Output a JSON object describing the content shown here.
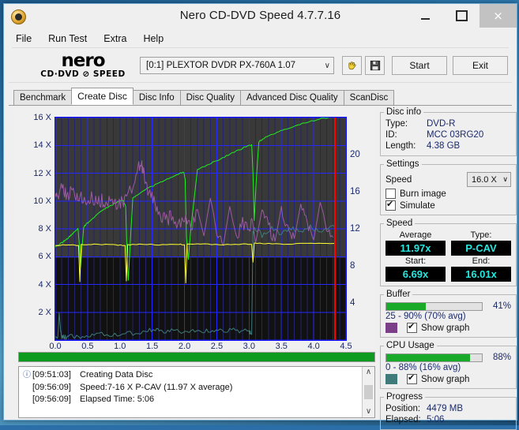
{
  "window": {
    "title": "Nero CD-DVD Speed 4.7.7.16",
    "icon": "disc-icon",
    "minimize": "–",
    "maximize": "□",
    "close": "×"
  },
  "menu": {
    "items": [
      "File",
      "Run Test",
      "Extra",
      "Help"
    ]
  },
  "logo": {
    "word": "nero",
    "sub": "CD·DVD ⊘ SPEED"
  },
  "toolbar": {
    "drive": "[0:1]   PLEXTOR DVDR   PX-760A 1.07",
    "chevron": "∨",
    "hand_icon": "hand-icon",
    "save_icon": "floppy-disk-icon",
    "start_label": "Start",
    "exit_label": "Exit"
  },
  "tabs": [
    {
      "label": "Benchmark",
      "active": false
    },
    {
      "label": "Create Disc",
      "active": true
    },
    {
      "label": "Disc Info",
      "active": false
    },
    {
      "label": "Disc Quality",
      "active": false
    },
    {
      "label": "Advanced Disc Quality",
      "active": false
    },
    {
      "label": "ScanDisc",
      "active": false
    }
  ],
  "disc_info": {
    "legend": "Disc info",
    "type_label": "Type:",
    "type_value": "DVD-R",
    "id_label": "ID:",
    "id_value": "MCC 03RG20",
    "length_label": "Length:",
    "length_value": "4.38 GB"
  },
  "settings": {
    "legend": "Settings",
    "speed_label": "Speed",
    "speed_value": "16.0 X",
    "chevron": "∨",
    "burn_image_label": "Burn image",
    "burn_image_checked": false,
    "simulate_label": "Simulate",
    "simulate_checked": true
  },
  "speed": {
    "legend": "Speed",
    "average_label": "Average",
    "average_value": "11.97x",
    "type_label": "Type:",
    "type_value": "P-CAV",
    "start_label": "Start:",
    "start_value": "6.69x",
    "end_label": "End:",
    "end_value": "16.01x"
  },
  "buffer": {
    "legend": "Buffer",
    "percent": "41%",
    "fill": 41,
    "range": "25 - 90% (70% avg)",
    "swatch": "#7a3f86",
    "show_graph_label": "Show graph",
    "show_graph_checked": true
  },
  "cpu": {
    "legend": "CPU Usage",
    "percent": "88%",
    "fill": 88,
    "range": "0 - 88% (16% avg)",
    "swatch": "#3f7b7b",
    "show_graph_label": "Show graph",
    "show_graph_checked": true
  },
  "progress": {
    "legend": "Progress",
    "position_label": "Position:",
    "position_value": "4479 MB",
    "elapsed_label": "Elapsed:",
    "elapsed_value": "5:06",
    "bar_fill": 100
  },
  "log": {
    "rows": [
      {
        "icon": "info-icon",
        "time": "[09:51:03]",
        "text": "Creating Data Disc"
      },
      {
        "icon": "",
        "time": "[09:56:09]",
        "text": "Speed:7-16 X P-CAV (11.97 X average)"
      },
      {
        "icon": "",
        "time": "[09:56:09]",
        "text": "Elapsed Time:  5:06"
      }
    ],
    "scroll_up": "∧",
    "scroll_down": "∨"
  },
  "chart_data": {
    "type": "line",
    "title": "",
    "xlabel": "",
    "ylabel": "",
    "xlim": [
      0,
      4.5
    ],
    "ylim": [
      0,
      16
    ],
    "y2lim": [
      0,
      24
    ],
    "grid": true,
    "legend": "none",
    "x_ticks": [
      "0.0",
      "0.5",
      "1.0",
      "1.5",
      "2.0",
      "2.5",
      "3.0",
      "3.5",
      "4.0",
      "4.5"
    ],
    "y_ticks_left": [
      "2 X",
      "4 X",
      "6 X",
      "8 X",
      "10 X",
      "12 X",
      "14 X",
      "16 X"
    ],
    "y_ticks_right": [
      "4",
      "8",
      "12",
      "16",
      "20"
    ],
    "marker_line_x": 4.33,
    "marker_color": "#ff0000",
    "series": [
      {
        "name": "write-speed",
        "color": "#22ee22",
        "axis": "left",
        "x": [
          0.0,
          0.05,
          0.1,
          0.15,
          0.2,
          0.25,
          0.3,
          0.35,
          0.37,
          0.39,
          0.41,
          0.44,
          0.48,
          0.55,
          0.65,
          0.75,
          0.85,
          0.95,
          1.05,
          1.09,
          1.11,
          1.13,
          1.16,
          1.2,
          1.28,
          1.4,
          1.52,
          1.65,
          1.78,
          1.9,
          1.99,
          2.01,
          2.03,
          2.06,
          2.1,
          2.2,
          2.35,
          2.5,
          2.65,
          2.8,
          2.95,
          3.04,
          3.06,
          3.08,
          3.11,
          3.15,
          3.25,
          3.4,
          3.55,
          3.7,
          3.85,
          4.0,
          4.15,
          4.25,
          4.33
        ],
        "y": [
          6.7,
          6.85,
          7.0,
          7.15,
          7.35,
          7.55,
          7.8,
          8.05,
          7.0,
          5.2,
          6.4,
          8.15,
          8.35,
          8.6,
          9.05,
          9.4,
          9.65,
          9.9,
          10.05,
          9.6,
          6.1,
          4.3,
          7.0,
          10.2,
          10.45,
          10.85,
          11.1,
          11.4,
          11.7,
          11.95,
          12.05,
          11.6,
          7.4,
          5.8,
          8.1,
          12.25,
          12.6,
          12.9,
          13.25,
          13.6,
          13.9,
          14.05,
          12.0,
          8.6,
          11.4,
          14.25,
          14.55,
          14.85,
          15.15,
          15.4,
          15.6,
          15.8,
          15.95,
          16.0,
          16.01
        ]
      },
      {
        "name": "cpu-usage",
        "color": "#3f7b7b",
        "axis": "right",
        "x": [
          0.0,
          0.04,
          0.06,
          0.08,
          0.1,
          0.14,
          0.2,
          0.3,
          0.45,
          0.6,
          0.8,
          1.0,
          1.2,
          1.4,
          1.55,
          1.65,
          1.8,
          1.95,
          2.1,
          2.25,
          2.4,
          2.55,
          2.7,
          2.85,
          3.0,
          3.04,
          3.06,
          3.1,
          3.2,
          3.35,
          3.5,
          3.65,
          3.8,
          3.95,
          4.1,
          4.25,
          4.33
        ],
        "y": [
          0.3,
          0.4,
          2.95,
          1.2,
          0.35,
          0.3,
          0.35,
          0.4,
          0.45,
          0.55,
          0.6,
          0.7,
          0.75,
          0.95,
          1.05,
          0.9,
          1.0,
          0.85,
          0.95,
          1.05,
          0.85,
          0.95,
          1.15,
          1.05,
          0.95,
          0.6,
          11.6,
          12.1,
          11.3,
          12.0,
          11.5,
          12.1,
          11.6,
          12.2,
          11.7,
          12.3,
          12.1
        ]
      },
      {
        "name": "buffer-level",
        "color": "#9b5ba0",
        "axis": "left",
        "x": [
          0.0,
          0.05,
          0.12,
          0.18,
          0.25,
          0.32,
          0.4,
          0.48,
          0.56,
          0.64,
          0.72,
          0.8,
          0.88,
          0.96,
          1.04,
          1.12,
          1.2,
          1.28,
          1.34,
          1.36,
          1.4,
          1.48,
          1.56,
          1.64,
          1.72,
          1.8,
          1.9,
          2.0,
          2.1,
          2.2,
          2.3,
          2.4,
          2.5,
          2.6,
          2.7,
          2.8,
          2.9,
          3.0,
          3.05,
          3.1,
          3.2,
          3.3,
          3.4,
          3.5,
          3.6,
          3.7,
          3.8,
          3.9,
          4.0,
          4.1,
          4.2,
          4.3
        ],
        "y": [
          10.8,
          10.6,
          10.95,
          10.4,
          10.7,
          10.1,
          10.3,
          9.95,
          10.2,
          9.9,
          10.05,
          9.8,
          10.0,
          9.7,
          9.95,
          10.35,
          11.1,
          12.3,
          12.7,
          12.1,
          11.2,
          10.35,
          9.6,
          8.9,
          8.6,
          8.95,
          8.4,
          8.7,
          8.1,
          9.4,
          7.5,
          10.2,
          8.0,
          6.8,
          9.6,
          7.4,
          8.5,
          7.9,
          8.6,
          7.0,
          9.3,
          8.2,
          7.1,
          9.5,
          8.1,
          7.3,
          9.8,
          8.4,
          7.2,
          9.9,
          8.3,
          7.4
        ]
      },
      {
        "name": "drive-rpm-or-ref",
        "color": "#ffff33",
        "axis": "left",
        "x": [
          0.0,
          0.2,
          0.36,
          0.38,
          0.4,
          0.6,
          0.9,
          1.08,
          1.1,
          1.12,
          1.3,
          1.6,
          1.9,
          2.0,
          2.02,
          2.04,
          2.3,
          2.6,
          2.9,
          3.04,
          3.06,
          3.08,
          3.3,
          3.6,
          3.9,
          4.2,
          4.33
        ],
        "y": [
          6.8,
          6.85,
          6.8,
          4.2,
          6.85,
          6.9,
          6.85,
          6.8,
          4.25,
          6.85,
          6.9,
          6.85,
          6.9,
          6.85,
          4.1,
          6.9,
          6.9,
          6.85,
          6.9,
          6.9,
          5.6,
          6.95,
          6.95,
          6.9,
          6.95,
          6.95,
          6.95
        ]
      }
    ]
  }
}
